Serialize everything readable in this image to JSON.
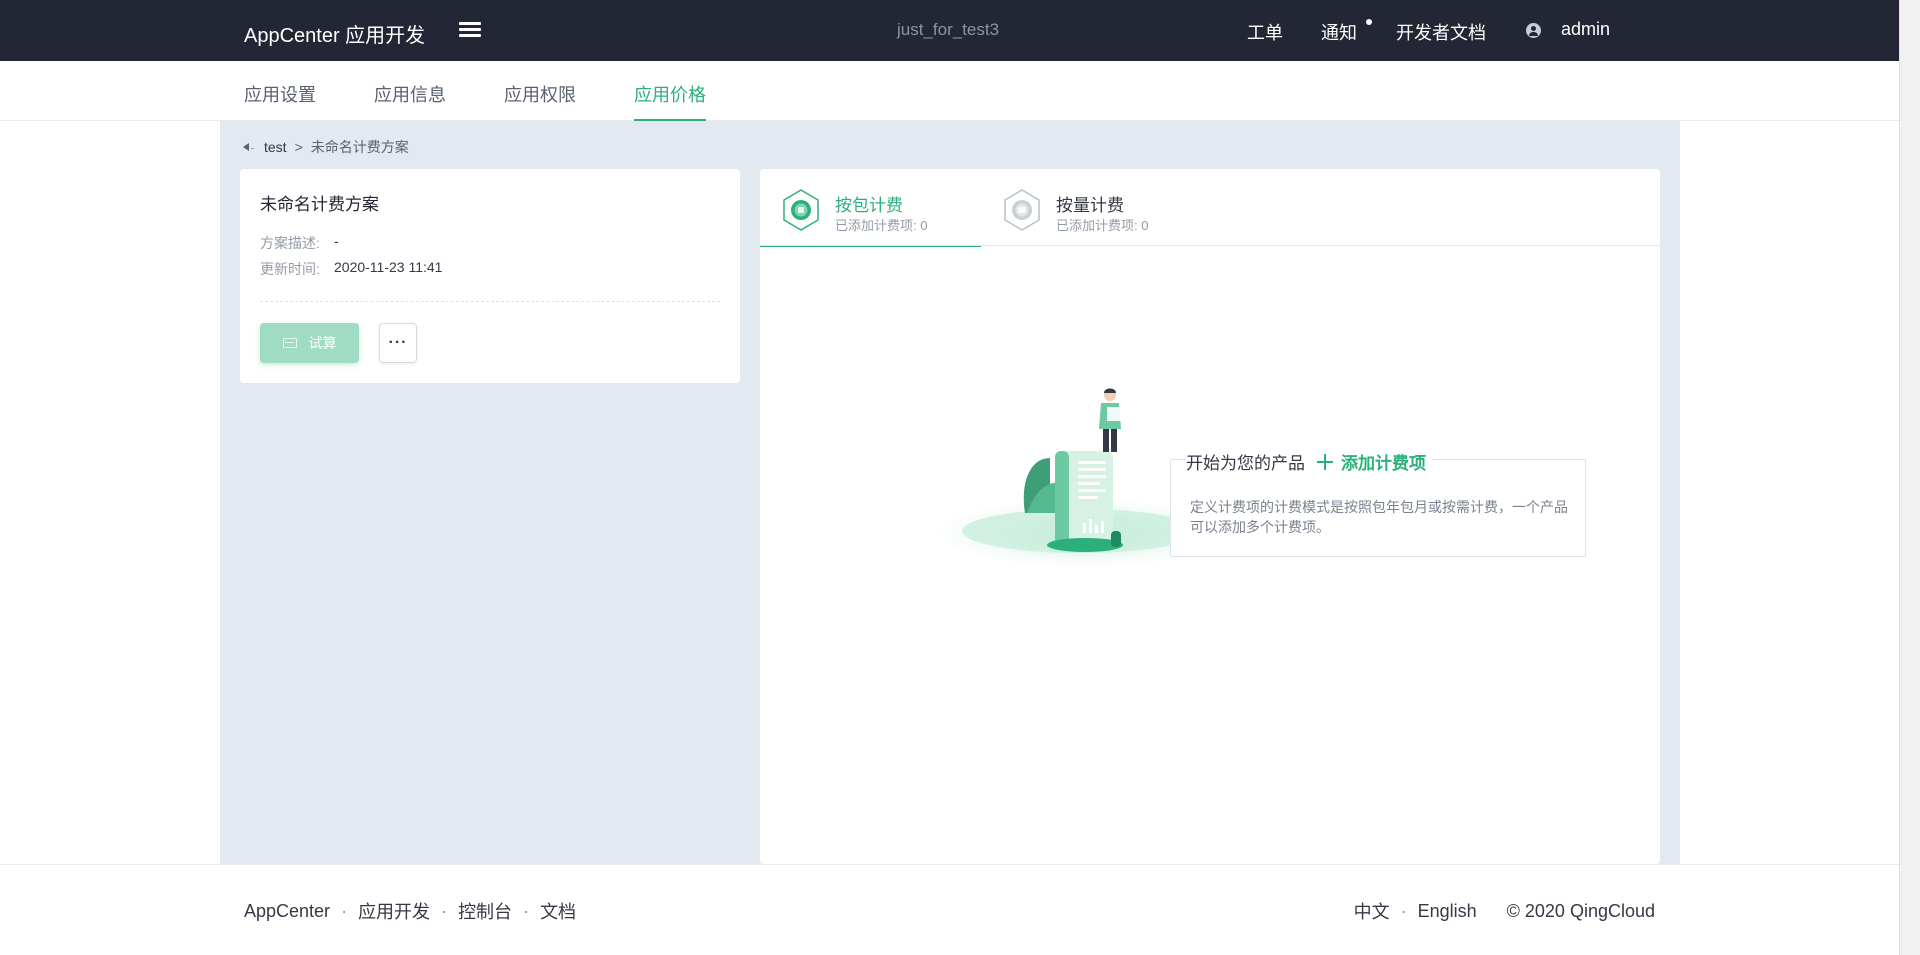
{
  "header": {
    "brand": "AppCenter 应用开发",
    "project": "just_for_test3",
    "nav": {
      "tickets": "工单",
      "notifications": "通知",
      "dev_docs": "开发者文档",
      "user": "admin"
    }
  },
  "subnav": {
    "tabs": [
      {
        "label": "应用设置",
        "active": false
      },
      {
        "label": "应用信息",
        "active": false
      },
      {
        "label": "应用权限",
        "active": false
      },
      {
        "label": "应用价格",
        "active": true
      }
    ]
  },
  "breadcrumb": {
    "parent": "test",
    "separator": ">",
    "current": "未命名计费方案"
  },
  "plan": {
    "title": "未命名计费方案",
    "description_label": "方案描述:",
    "description_value": "-",
    "updated_label": "更新时间:",
    "updated_value": "2020-11-23 11:41",
    "calc_button": "试算",
    "more_button": "···"
  },
  "billing_tabs": [
    {
      "title": "按包计费",
      "subtitle": "已添加计费项: 0",
      "active": true,
      "icon": "package-billing-icon"
    },
    {
      "title": "按量计费",
      "subtitle": "已添加计费项: 0",
      "active": false,
      "icon": "usage-billing-icon"
    }
  ],
  "empty_state": {
    "headline": "开始为您的产品",
    "add_link": "添加计费项",
    "description": "定义计费项的计费模式是按照包年包月或按需计费，一个产品可以添加多个计费项。"
  },
  "footer": {
    "links": [
      "AppCenter",
      "应用开发",
      "控制台",
      "文档"
    ],
    "separator": "·",
    "lang_zh": "中文",
    "lang_en": "English",
    "copyright": "© 2020 QingCloud"
  },
  "colors": {
    "accent": "#2cb07b",
    "topbar": "#232735",
    "content_bg": "#e3e9f0"
  }
}
